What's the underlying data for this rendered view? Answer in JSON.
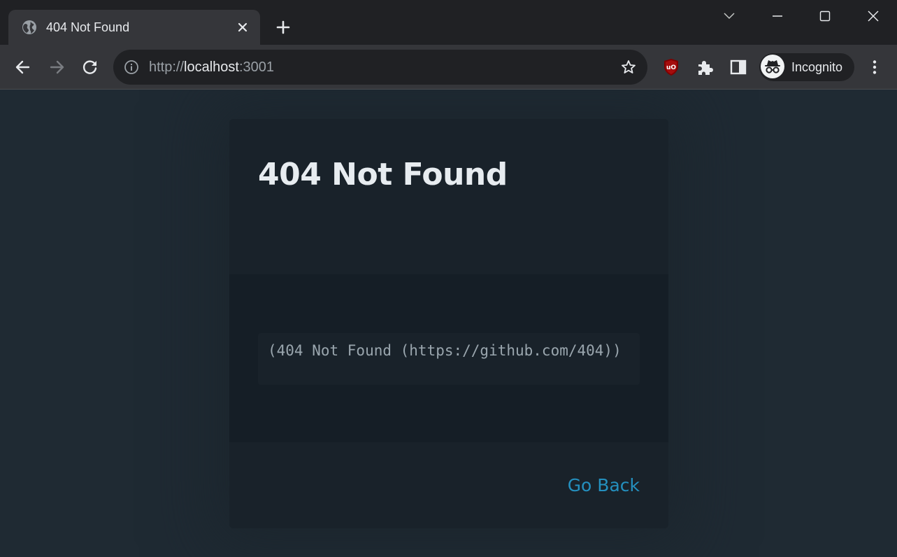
{
  "browser": {
    "tab": {
      "title": "404 Not Found",
      "favicon": "globe-icon"
    },
    "window_controls": [
      "tab-search-icon",
      "minimize-icon",
      "maximize-icon",
      "close-window-icon"
    ],
    "toolbar": {
      "back": "back-arrow-icon",
      "forward": "forward-arrow-icon",
      "reload": "reload-icon",
      "url": {
        "scheme": "http://",
        "host": "localhost",
        "port": ":3001"
      },
      "extensions": [
        "ublock-origin-icon",
        "extensions-puzzle-icon",
        "side-panel-icon"
      ],
      "profile_label": "Incognito"
    }
  },
  "page": {
    "title": "404 Not Found",
    "error_message": "(404 Not Found (https://github.com/404))",
    "go_back_label": "Go Back"
  },
  "colors": {
    "chrome_frame": "#202124",
    "toolbar": "#35363a",
    "page_background": "#1f2a33",
    "card_background": "#19222a",
    "card_body_background": "#151e26",
    "link": "#2490bf",
    "title_text": "#e7ecf0"
  }
}
